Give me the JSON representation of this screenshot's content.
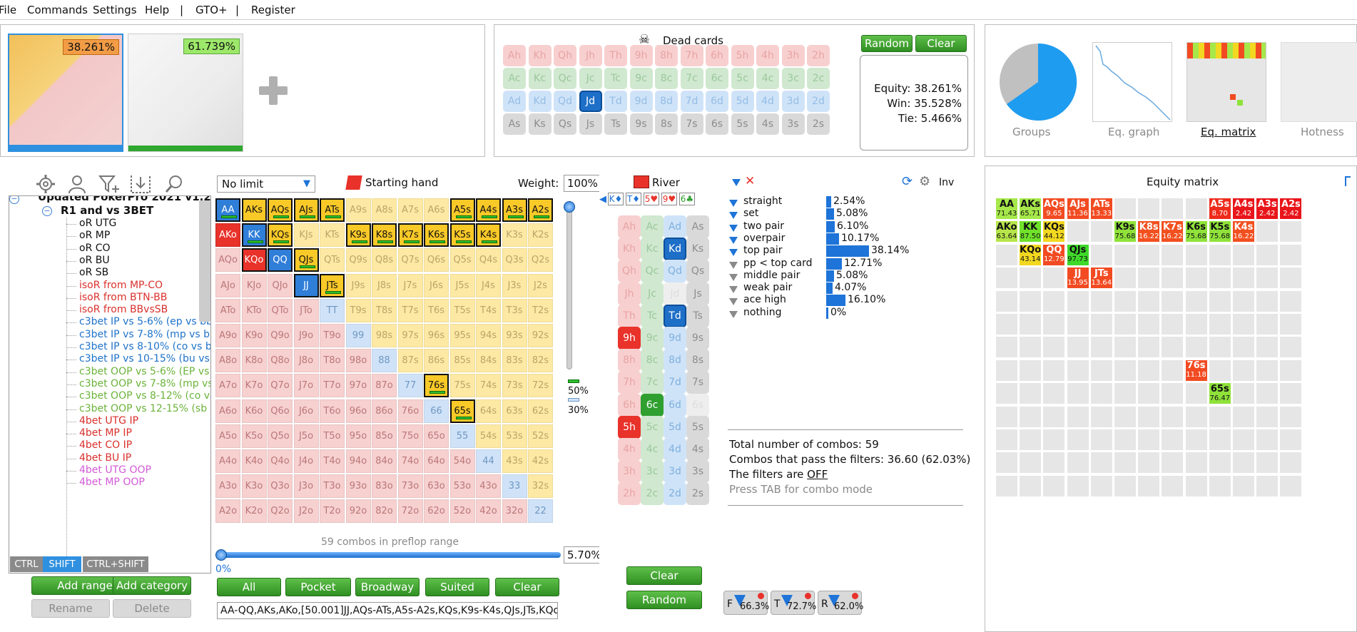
{
  "menu": [
    "File",
    "Commands",
    "Settings",
    "Help",
    "|",
    "GTO+",
    "|",
    "Register"
  ],
  "ranges": {
    "range1_pct": "38.261%",
    "range2_pct": "61.739%",
    "add_icon": "plus-icon"
  },
  "dead_cards": {
    "title": "Dead cards",
    "random_label": "Random",
    "clear_label": "Clear",
    "rows": [
      [
        "Ah",
        "Kh",
        "Qh",
        "Jh",
        "Th",
        "9h",
        "8h",
        "7h",
        "6h",
        "5h",
        "4h",
        "3h",
        "2h"
      ],
      [
        "Ac",
        "Kc",
        "Qc",
        "Jc",
        "Tc",
        "9c",
        "8c",
        "7c",
        "6c",
        "5c",
        "4c",
        "3c",
        "2c"
      ],
      [
        "Ad",
        "Kd",
        "Qd",
        "Jd",
        "Td",
        "9d",
        "8d",
        "7d",
        "6d",
        "5d",
        "4d",
        "3d",
        "2d"
      ],
      [
        "As",
        "Ks",
        "Qs",
        "Js",
        "Ts",
        "9s",
        "8s",
        "7s",
        "6s",
        "5s",
        "4s",
        "3s",
        "2s"
      ]
    ],
    "equity": "Equity: 38.261%",
    "win": "Win: 35.528%",
    "tie": "Tie: 5.466%"
  },
  "tabs": [
    "Groups",
    "Eq. graph",
    "Eq. matrix",
    "Hotness"
  ],
  "toolbar_icons": [
    "gear-icon",
    "user-icon",
    "filter-plus-icon",
    "import-icon",
    "search-icon"
  ],
  "tree": {
    "root": "Updated PokerPro 2021 v1.2",
    "category": "R1 and vs 3BET",
    "items": [
      {
        "label": "oR UTG",
        "color": "#111"
      },
      {
        "label": "oR MP",
        "color": "#111"
      },
      {
        "label": "oR CO",
        "color": "#111"
      },
      {
        "label": "oR BU",
        "color": "#111"
      },
      {
        "label": "oR SB",
        "color": "#111"
      },
      {
        "label": "isoR from MP-CO",
        "color": "#d9302c"
      },
      {
        "label": "isoR from BTN-BB",
        "color": "#d9302c"
      },
      {
        "label": "isoR from BBvsSB",
        "color": "#d9302c"
      },
      {
        "label": "c3bet IP vs 5-6% (ep vs bb",
        "color": "#1f73c9"
      },
      {
        "label": "c3bet IP vs 7-8% (mp vs bb",
        "color": "#1f73c9"
      },
      {
        "label": "c3bet IP vs 8-10% (co vs bb",
        "color": "#1f73c9"
      },
      {
        "label": "c3bet IP vs 10-15% (bu vs",
        "color": "#1f73c9"
      },
      {
        "label": "c3bet OOP vs 5-6% (EP vs",
        "color": "#6bb33a"
      },
      {
        "label": "c3bet OOP vs 7-8% (mp vs",
        "color": "#6bb33a"
      },
      {
        "label": "c3bet OOP vs 8-12% (co vs",
        "color": "#6bb33a"
      },
      {
        "label": "c3bet OOP vs 12-15% (sb",
        "color": "#6bb33a"
      },
      {
        "label": "4bet UTG IP",
        "color": "#d9302c"
      },
      {
        "label": "4bet MP IP",
        "color": "#d9302c"
      },
      {
        "label": "4bet CO IP",
        "color": "#d9302c"
      },
      {
        "label": "4bet BU IP",
        "color": "#d9302c"
      },
      {
        "label": "4bet UTG OOP",
        "color": "#d25ad6"
      },
      {
        "label": "4bet MP OOP",
        "color": "#d25ad6"
      }
    ],
    "modifier_tabs": [
      "CTRL",
      "SHIFT",
      "CTRL+SHIFT"
    ],
    "add_range": "Add range",
    "add_category": "Add category",
    "rename": "Rename",
    "delete": "Delete"
  },
  "hand_grid": {
    "limit": "No limit",
    "title": "Starting hand",
    "weight_label": "Weight:",
    "weight_value": "100%",
    "ranks": [
      "A",
      "K",
      "Q",
      "J",
      "T",
      "9",
      "8",
      "7",
      "6",
      "5",
      "4",
      "3",
      "2"
    ],
    "combos_label": "59 combos in preflop range",
    "slider_min": "0%",
    "slider_pct": "5.70%",
    "side_50": "50%",
    "side_30": "30%",
    "buttons": [
      "All",
      "Pocket",
      "Broadway",
      "Suited",
      "Clear"
    ],
    "range_text": "AA-QQ,AKs,AKo,[50.001]JJ,AQs-ATs,A5s-A2s,KQs,K9s-K4s,QJs,JTs,KQo"
  },
  "river": {
    "title": "River",
    "board": [
      "K♦",
      "T♦",
      "5♥",
      "9♥",
      "6♣"
    ],
    "clear_label": "Clear",
    "random_label": "Random"
  },
  "stats": {
    "inv_label": "Inv",
    "rows": [
      {
        "label": "straight",
        "pct": "2.54%",
        "value": 2.54,
        "active": true
      },
      {
        "label": "set",
        "pct": "5.08%",
        "value": 5.08,
        "active": true
      },
      {
        "label": "two pair",
        "pct": "6.10%",
        "value": 6.1,
        "active": true
      },
      {
        "label": "overpair",
        "pct": "10.17%",
        "value": 10.17,
        "active": true
      },
      {
        "label": "top pair",
        "pct": "38.14%",
        "value": 38.14,
        "active": true
      },
      {
        "label": "pp < top card",
        "pct": "12.71%",
        "value": 12.71,
        "active": false
      },
      {
        "label": "middle pair",
        "pct": "5.08%",
        "value": 5.08,
        "active": false
      },
      {
        "label": "weak pair",
        "pct": "4.07%",
        "value": 4.07,
        "active": false
      },
      {
        "label": "ace high",
        "pct": "16.10%",
        "value": 16.1,
        "active": false
      },
      {
        "label": "nothing",
        "pct": "0%",
        "value": 0,
        "active": false
      }
    ],
    "total": "Total number of combos: 59",
    "pass": "Combos that pass the filters: 36.60 (62.03%)",
    "filters_prefix": "The filters are ",
    "filters_state": "OFF",
    "tab_hint": "Press TAB for combo mode",
    "filter_chips": [
      {
        "letter": "F",
        "pct": "66.3%"
      },
      {
        "letter": "T",
        "pct": "72.7%"
      },
      {
        "letter": "R",
        "pct": "62.0%"
      }
    ]
  },
  "equity_matrix": {
    "title": "Equity matrix",
    "cells": [
      {
        "r": 0,
        "c": 0,
        "hand": "AA",
        "eq": "71.43",
        "color": "#a6e84a"
      },
      {
        "r": 0,
        "c": 1,
        "hand": "AKs",
        "eq": "65.71",
        "color": "#a6e84a"
      },
      {
        "r": 0,
        "c": 2,
        "hand": "AQs",
        "eq": "9.65",
        "color": "#f24b22"
      },
      {
        "r": 0,
        "c": 3,
        "hand": "AJs",
        "eq": "11.36",
        "color": "#f24b22"
      },
      {
        "r": 0,
        "c": 4,
        "hand": "ATs",
        "eq": "13.33",
        "color": "#f24b22"
      },
      {
        "r": 0,
        "c": 9,
        "hand": "A5s",
        "eq": "8.70",
        "color": "#ee2b1a"
      },
      {
        "r": 0,
        "c": 10,
        "hand": "A4s",
        "eq": "2.42",
        "color": "#e8151a"
      },
      {
        "r": 0,
        "c": 11,
        "hand": "A3s",
        "eq": "2.42",
        "color": "#e8151a"
      },
      {
        "r": 0,
        "c": 12,
        "hand": "A2s",
        "eq": "2.42",
        "color": "#e8151a"
      },
      {
        "r": 1,
        "c": 0,
        "hand": "AKo",
        "eq": "63.64",
        "color": "#b7e64a"
      },
      {
        "r": 1,
        "c": 1,
        "hand": "KK",
        "eq": "87.50",
        "color": "#6fe22a"
      },
      {
        "r": 1,
        "c": 2,
        "hand": "KQs",
        "eq": "44.12",
        "color": "#f2d820"
      },
      {
        "r": 1,
        "c": 5,
        "hand": "K9s",
        "eq": "75.68",
        "color": "#8fe23a"
      },
      {
        "r": 1,
        "c": 6,
        "hand": "K8s",
        "eq": "16.22",
        "color": "#f2501f"
      },
      {
        "r": 1,
        "c": 7,
        "hand": "K7s",
        "eq": "16.22",
        "color": "#f2501f"
      },
      {
        "r": 1,
        "c": 8,
        "hand": "K6s",
        "eq": "75.68",
        "color": "#8fe23a"
      },
      {
        "r": 1,
        "c": 9,
        "hand": "K5s",
        "eq": "75.68",
        "color": "#8fe23a"
      },
      {
        "r": 1,
        "c": 10,
        "hand": "K4s",
        "eq": "16.22",
        "color": "#f2501f"
      },
      {
        "r": 2,
        "c": 1,
        "hand": "KQo",
        "eq": "43.14",
        "color": "#f2d820"
      },
      {
        "r": 2,
        "c": 2,
        "hand": "QQ",
        "eq": "12.79",
        "color": "#f24b22"
      },
      {
        "r": 2,
        "c": 3,
        "hand": "QJs",
        "eq": "97.73",
        "color": "#3fd92a"
      },
      {
        "r": 3,
        "c": 3,
        "hand": "JJ",
        "eq": "13.95",
        "color": "#f24b22"
      },
      {
        "r": 3,
        "c": 4,
        "hand": "JTs",
        "eq": "13.64",
        "color": "#f24b22"
      },
      {
        "r": 7,
        "c": 8,
        "hand": "76s",
        "eq": "11.18",
        "color": "#f24b22"
      },
      {
        "r": 8,
        "c": 9,
        "hand": "65s",
        "eq": "76.47",
        "color": "#8fe23a"
      }
    ]
  }
}
